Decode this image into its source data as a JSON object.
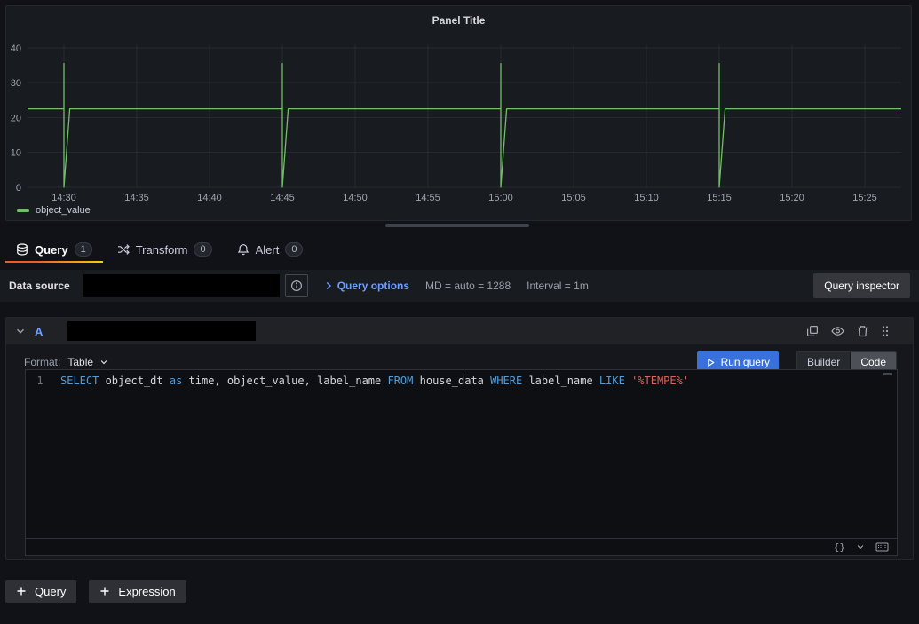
{
  "panel": {
    "title": "Panel Title",
    "legend_label": "object_value"
  },
  "chart_data": {
    "type": "line",
    "title": "Panel Title",
    "xlabel": "",
    "ylabel": "",
    "x_domain": [
      0,
      60
    ],
    "x_ticks": [
      {
        "m": 2.5,
        "label": "14:30"
      },
      {
        "m": 7.5,
        "label": "14:35"
      },
      {
        "m": 12.5,
        "label": "14:40"
      },
      {
        "m": 17.5,
        "label": "14:45"
      },
      {
        "m": 22.5,
        "label": "14:50"
      },
      {
        "m": 27.5,
        "label": "14:55"
      },
      {
        "m": 32.5,
        "label": "15:00"
      },
      {
        "m": 37.5,
        "label": "15:05"
      },
      {
        "m": 42.5,
        "label": "15:10"
      },
      {
        "m": 47.5,
        "label": "15:15"
      },
      {
        "m": 52.5,
        "label": "15:20"
      },
      {
        "m": 57.5,
        "label": "15:25"
      }
    ],
    "y_ticks": [
      0,
      10,
      20,
      30,
      40
    ],
    "ylim": [
      0,
      41
    ],
    "grid": true,
    "legend_position": "bottom-left",
    "series": [
      {
        "name": "object_value",
        "color": "#73bf69",
        "points": [
          [
            0,
            22.5
          ],
          [
            2.5,
            22.5
          ],
          [
            2.5,
            35.5
          ],
          [
            2.5,
            0
          ],
          [
            2.9,
            22.5
          ],
          [
            17.5,
            22.5
          ],
          [
            17.5,
            35.5
          ],
          [
            17.5,
            0
          ],
          [
            17.9,
            22.5
          ],
          [
            32.5,
            22.5
          ],
          [
            32.5,
            35.5
          ],
          [
            32.5,
            0
          ],
          [
            32.9,
            22.5
          ],
          [
            47.5,
            22.5
          ],
          [
            47.5,
            35.5
          ],
          [
            47.5,
            0
          ],
          [
            47.9,
            22.5
          ],
          [
            60,
            22.5
          ]
        ]
      }
    ]
  },
  "tabs": [
    {
      "label": "Query",
      "badge": "1",
      "active": true
    },
    {
      "label": "Transform",
      "badge": "0",
      "active": false
    },
    {
      "label": "Alert",
      "badge": "0",
      "active": false
    }
  ],
  "datasource_bar": {
    "label": "Data source",
    "query_options_label": "Query options",
    "max_data_points": "MD = auto = 1288",
    "interval": "Interval = 1m",
    "query_inspector_label": "Query inspector"
  },
  "query_editor": {
    "ref_id": "A",
    "format_label": "Format:",
    "format_value": "Table",
    "run_query_label": "Run query",
    "builder_label": "Builder",
    "code_label": "Code",
    "line_number": "1",
    "footer_braces": "{}",
    "sql_tokens": [
      {
        "text": "SELECT",
        "type": "keyword"
      },
      {
        "text": " object_dt ",
        "type": "plain"
      },
      {
        "text": "as",
        "type": "keyword"
      },
      {
        "text": " time, object_value, label_name ",
        "type": "plain"
      },
      {
        "text": "FROM",
        "type": "keyword"
      },
      {
        "text": " house_data ",
        "type": "plain"
      },
      {
        "text": "WHERE",
        "type": "keyword"
      },
      {
        "text": " label_name ",
        "type": "plain"
      },
      {
        "text": "LIKE",
        "type": "keyword"
      },
      {
        "text": " ",
        "type": "plain"
      },
      {
        "text": "'%TEMPE%'",
        "type": "string"
      }
    ]
  },
  "footer": {
    "add_query_label": "Query",
    "add_expression_label": "Expression"
  },
  "colors": {
    "accent_orange": "#f05a28",
    "link_blue": "#6e9fff",
    "primary_blue": "#3871dc",
    "series_green": "#73bf69"
  }
}
